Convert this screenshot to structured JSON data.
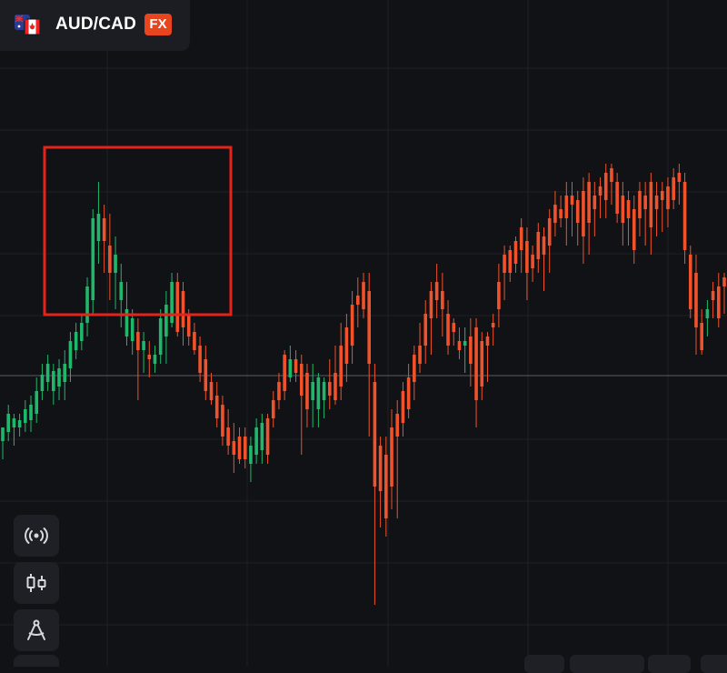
{
  "instrument": {
    "symbol": "AUD/CAD",
    "badge": "FX",
    "flag_icons": [
      "australia-flag-icon",
      "canada-flag-icon"
    ]
  },
  "toolbar": {
    "items": [
      {
        "name": "broadcast-signal-icon"
      },
      {
        "name": "candlestick-type-icon"
      },
      {
        "name": "drawing-compass-icon"
      }
    ]
  },
  "highlight": {
    "color": "#e5231b"
  },
  "colors": {
    "background": "#111216",
    "bullish": "#1fb86b",
    "bearish": "#f0522b",
    "grid": "#1f2026",
    "badge": "#e8451f"
  },
  "chart_data": {
    "type": "candlestick",
    "candles": [
      [
        470,
        505,
        485,
        470
      ],
      [
        445,
        485,
        475,
        455
      ],
      [
        455,
        490,
        470,
        460
      ],
      [
        455,
        480,
        470,
        462
      ],
      [
        440,
        475,
        465,
        450
      ],
      [
        435,
        475,
        462,
        445
      ],
      [
        415,
        465,
        455,
        430
      ],
      [
        400,
        440,
        430,
        412
      ],
      [
        390,
        430,
        420,
        400
      ],
      [
        400,
        445,
        430,
        408
      ],
      [
        395,
        440,
        425,
        405
      ],
      [
        385,
        440,
        420,
        400
      ],
      [
        365,
        420,
        405,
        375
      ],
      [
        355,
        395,
        385,
        365
      ],
      [
        345,
        385,
        375,
        355
      ],
      [
        305,
        370,
        355,
        315
      ],
      [
        230,
        345,
        330,
        240
      ],
      [
        200,
        290,
        265,
        235
      ],
      [
        225,
        300,
        240,
        265
      ],
      [
        235,
        330,
        270,
        300
      ],
      [
        260,
        340,
        300,
        280
      ],
      [
        290,
        360,
        330,
        310
      ],
      [
        310,
        380,
        370,
        340
      ],
      [
        340,
        390,
        375,
        350
      ],
      [
        350,
        440,
        365,
        385
      ],
      [
        365,
        410,
        385,
        375
      ],
      [
        375,
        415,
        390,
        395
      ],
      [
        380,
        410,
        400,
        390
      ],
      [
        340,
        400,
        390,
        350
      ],
      [
        320,
        400,
        370,
        335
      ],
      [
        300,
        360,
        355,
        310
      ],
      [
        300,
        370,
        310,
        365
      ],
      [
        310,
        380,
        320,
        360
      ],
      [
        340,
        380,
        345,
        370
      ],
      [
        355,
        390,
        365,
        385
      ],
      [
        370,
        420,
        380,
        410
      ],
      [
        380,
        440,
        395,
        430
      ],
      [
        410,
        445,
        420,
        440
      ],
      [
        420,
        470,
        435,
        460
      ],
      [
        435,
        490,
        445,
        480
      ],
      [
        450,
        500,
        470,
        490
      ],
      [
        465,
        520,
        485,
        500
      ],
      [
        470,
        510,
        480,
        505
      ],
      [
        470,
        515,
        480,
        505
      ],
      [
        480,
        530,
        510,
        490
      ],
      [
        460,
        510,
        500,
        470
      ],
      [
        455,
        510,
        495,
        465
      ],
      [
        455,
        510,
        460,
        500
      ],
      [
        430,
        470,
        440,
        460
      ],
      [
        410,
        450,
        420,
        440
      ],
      [
        385,
        440,
        390,
        430
      ],
      [
        380,
        420,
        415,
        395
      ],
      [
        385,
        420,
        395,
        410
      ],
      [
        390,
        500,
        400,
        435
      ],
      [
        400,
        470,
        410,
        450
      ],
      [
        400,
        470,
        440,
        420
      ],
      [
        410,
        470,
        450,
        415
      ],
      [
        415,
        460,
        440,
        420
      ],
      [
        395,
        450,
        420,
        435
      ],
      [
        380,
        445,
        410,
        440
      ],
      [
        355,
        440,
        380,
        425
      ],
      [
        345,
        420,
        360,
        400
      ],
      [
        320,
        400,
        335,
        380
      ],
      [
        305,
        360,
        325,
        335
      ],
      [
        300,
        350,
        310,
        340
      ],
      [
        300,
        480,
        320,
        400
      ],
      [
        400,
        665,
        420,
        535
      ],
      [
        480,
        580,
        490,
        540
      ],
      [
        480,
        590,
        500,
        570
      ],
      [
        450,
        560,
        470,
        535
      ],
      [
        440,
        570,
        455,
        480
      ],
      [
        420,
        480,
        430,
        465
      ],
      [
        400,
        460,
        415,
        450
      ],
      [
        380,
        440,
        390,
        420
      ],
      [
        355,
        410,
        380,
        400
      ],
      [
        330,
        400,
        345,
        380
      ],
      [
        310,
        390,
        320,
        350
      ],
      [
        290,
        350,
        310,
        330
      ],
      [
        300,
        370,
        320,
        340
      ],
      [
        330,
        390,
        345,
        380
      ],
      [
        350,
        380,
        355,
        365
      ],
      [
        360,
        395,
        375,
        385
      ],
      [
        360,
        410,
        380,
        375
      ],
      [
        350,
        425,
        370,
        400
      ],
      [
        350,
        470,
        360,
        440
      ],
      [
        365,
        440,
        375,
        425
      ],
      [
        365,
        420,
        370,
        380
      ],
      [
        345,
        380,
        355,
        360
      ],
      [
        290,
        360,
        310,
        340
      ],
      [
        270,
        330,
        280,
        300
      ],
      [
        270,
        310,
        275,
        300
      ],
      [
        260,
        300,
        265,
        290
      ],
      [
        240,
        300,
        250,
        275
      ],
      [
        250,
        330,
        265,
        300
      ],
      [
        270,
        310,
        280,
        295
      ],
      [
        245,
        300,
        255,
        285
      ],
      [
        250,
        320,
        260,
        280
      ],
      [
        230,
        300,
        240,
        270
      ],
      [
        210,
        260,
        225,
        245
      ],
      [
        215,
        250,
        230,
        240
      ],
      [
        200,
        270,
        215,
        240
      ],
      [
        200,
        260,
        215,
        225
      ],
      [
        210,
        270,
        220,
        245
      ],
      [
        195,
        290,
        210,
        260
      ],
      [
        190,
        280,
        200,
        245
      ],
      [
        200,
        260,
        215,
        230
      ],
      [
        195,
        240,
        205,
        215
      ],
      [
        180,
        240,
        190,
        220
      ],
      [
        180,
        225,
        185,
        200
      ],
      [
        190,
        245,
        200,
        235
      ],
      [
        200,
        270,
        215,
        245
      ],
      [
        210,
        270,
        220,
        240
      ],
      [
        215,
        290,
        230,
        275
      ],
      [
        200,
        260,
        210,
        240
      ],
      [
        200,
        270,
        215,
        230
      ],
      [
        190,
        280,
        200,
        250
      ],
      [
        200,
        260,
        215,
        230
      ],
      [
        200,
        255,
        210,
        220
      ],
      [
        195,
        250,
        205,
        230
      ],
      [
        185,
        230,
        195,
        220
      ],
      [
        180,
        225,
        190,
        200
      ],
      [
        190,
        290,
        200,
        275
      ],
      [
        270,
        350,
        280,
        340
      ],
      [
        280,
        390,
        300,
        360
      ],
      [
        340,
        390,
        355,
        385
      ],
      [
        330,
        370,
        350,
        340
      ],
      [
        310,
        350,
        320,
        330
      ],
      [
        300,
        360,
        315,
        350
      ],
      [
        300,
        345,
        305,
        315
      ]
    ]
  }
}
